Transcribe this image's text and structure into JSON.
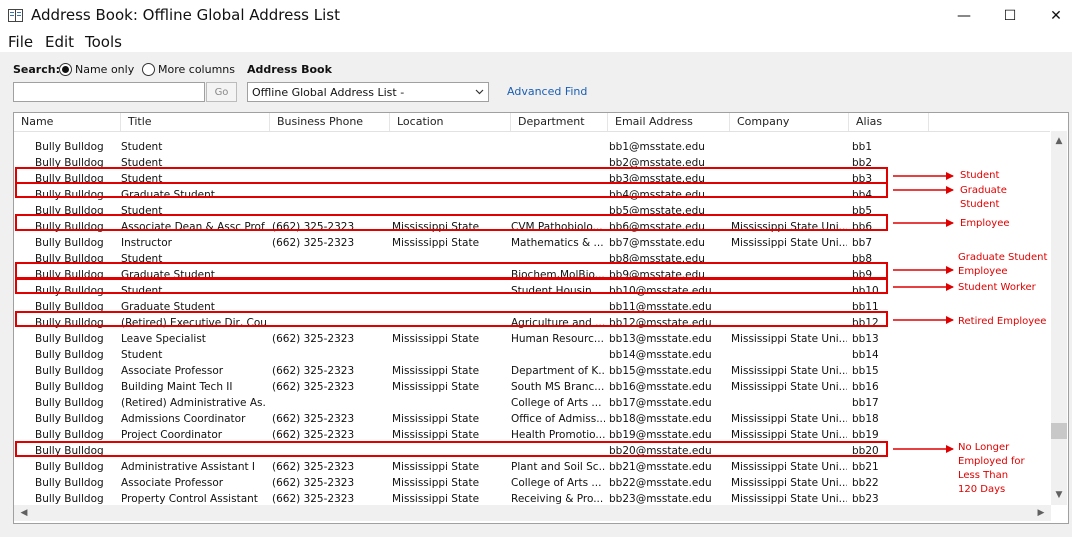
{
  "window": {
    "title": "Address Book: Offline Global Address List",
    "minimize_glyph": "—",
    "maximize_glyph": "☐",
    "close_glyph": "✕"
  },
  "menu": {
    "file": "File",
    "edit": "Edit",
    "tools": "Tools"
  },
  "search": {
    "label": "Search:",
    "name_only": "Name only",
    "more_columns": "More columns",
    "selected": "Name only",
    "input_value": "",
    "go_label": "Go"
  },
  "address_book": {
    "label": "Address Book",
    "selected": "Offline Global Address List -"
  },
  "advanced_find": "Advanced Find",
  "columns": [
    "Name",
    "Title",
    "Business Phone",
    "Location",
    "Department",
    "Email Address",
    "Company",
    "Alias"
  ],
  "rows": [
    [
      "Bully Bulldog",
      "Student",
      "",
      "",
      "",
      "bb1@msstate.edu",
      "",
      "bb1"
    ],
    [
      "Bully Bulldog",
      "Student",
      "",
      "",
      "",
      "bb2@msstate.edu",
      "",
      "bb2"
    ],
    [
      "Bully Bulldog",
      "Student",
      "",
      "",
      "",
      "bb3@msstate.edu",
      "",
      "bb3"
    ],
    [
      "Bully Bulldog",
      "Graduate Student",
      "",
      "",
      "",
      "bb4@msstate.edu",
      "",
      "bb4"
    ],
    [
      "Bully Bulldog",
      "Student",
      "",
      "",
      "",
      "bb5@msstate.edu",
      "",
      "bb5"
    ],
    [
      "Bully Bulldog",
      "Associate Dean & Assc Prof",
      "(662) 325-2323",
      "Mississippi State",
      "CVM Pathobiolo...",
      "bb6@msstate.edu",
      "Mississippi State Uni...",
      "bb6"
    ],
    [
      "Bully Bulldog",
      "Instructor",
      "(662) 325-2323",
      "Mississippi State",
      "Mathematics & ...",
      "bb7@msstate.edu",
      "Mississippi State Uni...",
      "bb7"
    ],
    [
      "Bully Bulldog",
      "Student",
      "",
      "",
      "",
      "bb8@msstate.edu",
      "",
      "bb8"
    ],
    [
      "Bully Bulldog",
      "Graduate Student",
      "",
      "",
      "Biochem,MolBio...",
      "bb9@msstate.edu",
      "",
      "bb9"
    ],
    [
      "Bully Bulldog",
      "Student",
      "",
      "",
      "Student Housin...",
      "bb10@msstate.edu",
      "",
      "bb10"
    ],
    [
      "Bully Bulldog",
      "Graduate Student",
      "",
      "",
      "",
      "bb11@msstate.edu",
      "",
      "bb11"
    ],
    [
      "Bully Bulldog",
      "(Retired) Executive Dir, Cou...",
      "",
      "",
      "Agriculture and ...",
      "bb12@msstate.edu",
      "",
      "bb12"
    ],
    [
      "Bully Bulldog",
      "Leave Specialist",
      "(662) 325-2323",
      "Mississippi State",
      "Human Resourc...",
      "bb13@msstate.edu",
      "Mississippi State Uni...",
      "bb13"
    ],
    [
      "Bully Bulldog",
      "Student",
      "",
      "",
      "",
      "bb14@msstate.edu",
      "",
      "bb14"
    ],
    [
      "Bully Bulldog",
      "Associate Professor",
      "(662) 325-2323",
      "Mississippi State",
      "Department of K...",
      "bb15@msstate.edu",
      "Mississippi State Uni...",
      "bb15"
    ],
    [
      "Bully Bulldog",
      "Building Maint Tech II",
      "(662) 325-2323",
      "Mississippi State",
      "South MS Branc...",
      "bb16@msstate.edu",
      "Mississippi State Uni...",
      "bb16"
    ],
    [
      "Bully Bulldog",
      "(Retired) Administrative As...",
      "",
      "",
      "College of Arts ...",
      "bb17@msstate.edu",
      "",
      "bb17"
    ],
    [
      "Bully Bulldog",
      "Admissions Coordinator",
      "(662) 325-2323",
      "Mississippi State",
      "Office of Admiss...",
      "bb18@msstate.edu",
      "Mississippi State Uni...",
      "bb18"
    ],
    [
      "Bully Bulldog",
      "Project Coordinator",
      "(662) 325-2323",
      "Mississippi State",
      "Health Promotio...",
      "bb19@msstate.edu",
      "Mississippi State Uni...",
      "bb19"
    ],
    [
      "Bully Bulldog",
      "",
      "",
      "",
      "",
      "bb20@msstate.edu",
      "",
      "bb20"
    ],
    [
      "Bully Bulldog",
      "Administrative Assistant I",
      "(662) 325-2323",
      "Mississippi State",
      "Plant and Soil Sc...",
      "bb21@msstate.edu",
      "Mississippi State Uni...",
      "bb21"
    ],
    [
      "Bully Bulldog",
      "Associate Professor",
      "(662) 325-2323",
      "Mississippi State",
      "College of Arts ...",
      "bb22@msstate.edu",
      "Mississippi State Uni...",
      "bb22"
    ],
    [
      "Bully Bulldog",
      "Property Control Assistant",
      "(662) 325-2323",
      "Mississippi State",
      "Receiving & Pro...",
      "bb23@msstate.edu",
      "Mississippi State Uni...",
      "bb23"
    ]
  ],
  "annotations": {
    "color": "#e00000",
    "student": "Student",
    "graduate": [
      "Graduate",
      "Student"
    ],
    "employee": "Employee",
    "grad_employee": [
      "Graduate Student",
      "Employee"
    ],
    "student_worker": "Student Worker",
    "retired": "Retired Employee",
    "no_longer": [
      "No Longer",
      "Employed for",
      "Less Than",
      "120 Days"
    ]
  }
}
